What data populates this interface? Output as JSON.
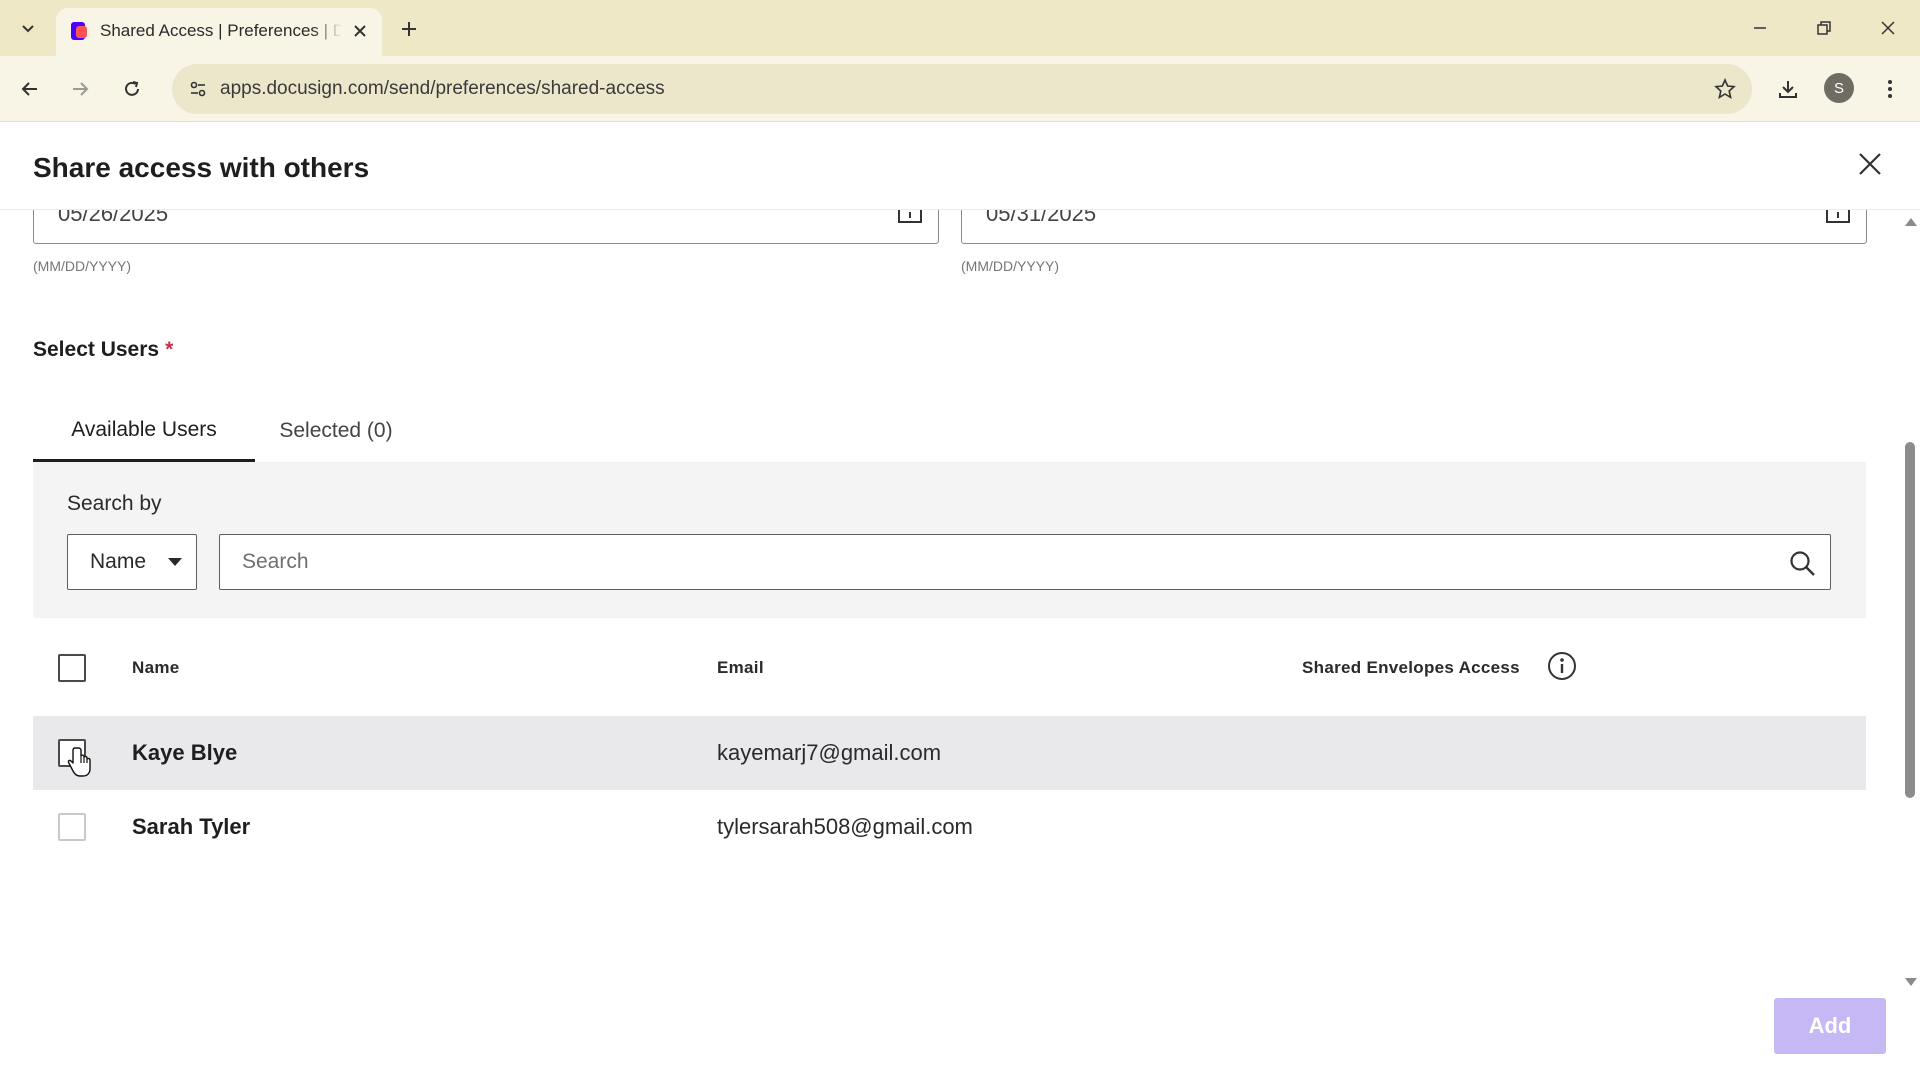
{
  "browser": {
    "tab_title": "Shared Access | Preferences | DocuSign",
    "url": "apps.docusign.com/send/preferences/shared-access",
    "profile_initial": "S"
  },
  "modal": {
    "title": "Share access with others",
    "start_date": "05/26/2025",
    "end_date": "05/31/2025",
    "date_format_hint": "(MM/DD/YYYY)",
    "select_users_label": "Select Users",
    "required_mark": "*",
    "tabs": [
      {
        "label": "Available Users",
        "active": true
      },
      {
        "label": "Selected (0)",
        "active": false
      }
    ],
    "search_by_label": "Search by",
    "search_by_value": "Name",
    "search_placeholder": "Search",
    "table": {
      "columns": [
        "Name",
        "Email",
        "Shared Envelopes Access"
      ],
      "rows": [
        {
          "name": "Kaye Blye",
          "email": "kayemarj7@gmail.com",
          "checked": false
        },
        {
          "name": "Sarah Tyler",
          "email": "tylersarah508@gmail.com",
          "checked": false
        }
      ]
    },
    "add_button": "Add"
  },
  "colors": {
    "tabstrip_bg": "#efe8c6",
    "toolbar_bg": "#f8f5e6",
    "add_button_disabled": "#c5b8f4",
    "required": "#c9314b"
  }
}
